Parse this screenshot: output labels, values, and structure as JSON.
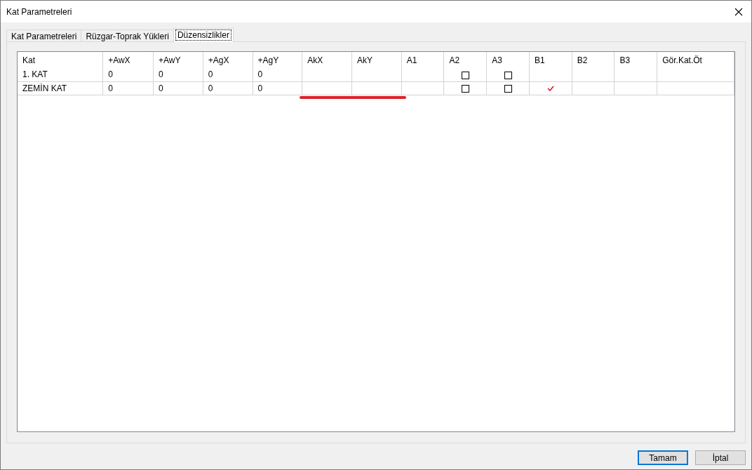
{
  "window": {
    "title": "Kat Parametreleri"
  },
  "tabs": [
    {
      "label": "Kat Parametreleri",
      "selected": false
    },
    {
      "label": "Rüzgar-Toprak Yükleri",
      "selected": false
    },
    {
      "label": "Düzensizlikler",
      "selected": true
    }
  ],
  "table": {
    "columns": [
      "Kat",
      "+AwX",
      "+AwY",
      "+AgX",
      "+AgY",
      "AkX",
      "AkY",
      "A1",
      "A2",
      "A3",
      "B1",
      "B2",
      "B3",
      "Gör.Kat.Öt"
    ],
    "rows": [
      [
        {
          "kind": "text",
          "text": "1. KAT"
        },
        {
          "kind": "text",
          "text": "0"
        },
        {
          "kind": "text",
          "text": "0"
        },
        {
          "kind": "text",
          "text": "0"
        },
        {
          "kind": "text",
          "text": "0"
        },
        {
          "kind": "empty"
        },
        {
          "kind": "empty"
        },
        {
          "kind": "empty"
        },
        {
          "kind": "checkbox",
          "checked": false
        },
        {
          "kind": "checkbox",
          "checked": false
        },
        {
          "kind": "tick",
          "checked": false
        },
        {
          "kind": "empty"
        },
        {
          "kind": "empty"
        },
        {
          "kind": "empty"
        }
      ],
      [
        {
          "kind": "text",
          "text": "ZEMİN KAT"
        },
        {
          "kind": "text",
          "text": "0"
        },
        {
          "kind": "text",
          "text": "0"
        },
        {
          "kind": "text",
          "text": "0"
        },
        {
          "kind": "text",
          "text": "0"
        },
        {
          "kind": "empty"
        },
        {
          "kind": "empty"
        },
        {
          "kind": "empty"
        },
        {
          "kind": "checkbox",
          "checked": false
        },
        {
          "kind": "checkbox",
          "checked": false
        },
        {
          "kind": "tick",
          "checked": true
        },
        {
          "kind": "empty"
        },
        {
          "kind": "empty"
        },
        {
          "kind": "empty"
        }
      ]
    ]
  },
  "buttons": [
    {
      "label": "Tamam",
      "default": true
    },
    {
      "label": "İptal",
      "default": false
    }
  ]
}
